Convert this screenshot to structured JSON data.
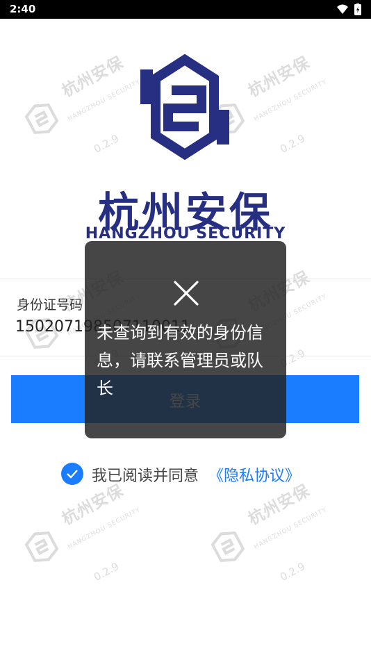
{
  "status_bar": {
    "time": "2:40",
    "icons": [
      "wifi-icon",
      "battery-charging-icon"
    ]
  },
  "watermark": {
    "name_cn": "杭州安保",
    "name_en": "HANGZHOU SECURITY",
    "version": "0.2.9"
  },
  "brand": {
    "name_cn": "杭州安保",
    "name_en": "HANGZHOU SECURITY",
    "color": "#262f82"
  },
  "form": {
    "id_label": "身份证号码",
    "id_value": "150207198507110011"
  },
  "login": {
    "label": "登录",
    "color": "#1a7cff"
  },
  "agreement": {
    "checked": true,
    "text": "我已阅读并同意",
    "link": "《隐私协议》"
  },
  "toast": {
    "icon": "close-icon",
    "message": "未查询到有效的身份信息，请联系管理员或队长"
  }
}
